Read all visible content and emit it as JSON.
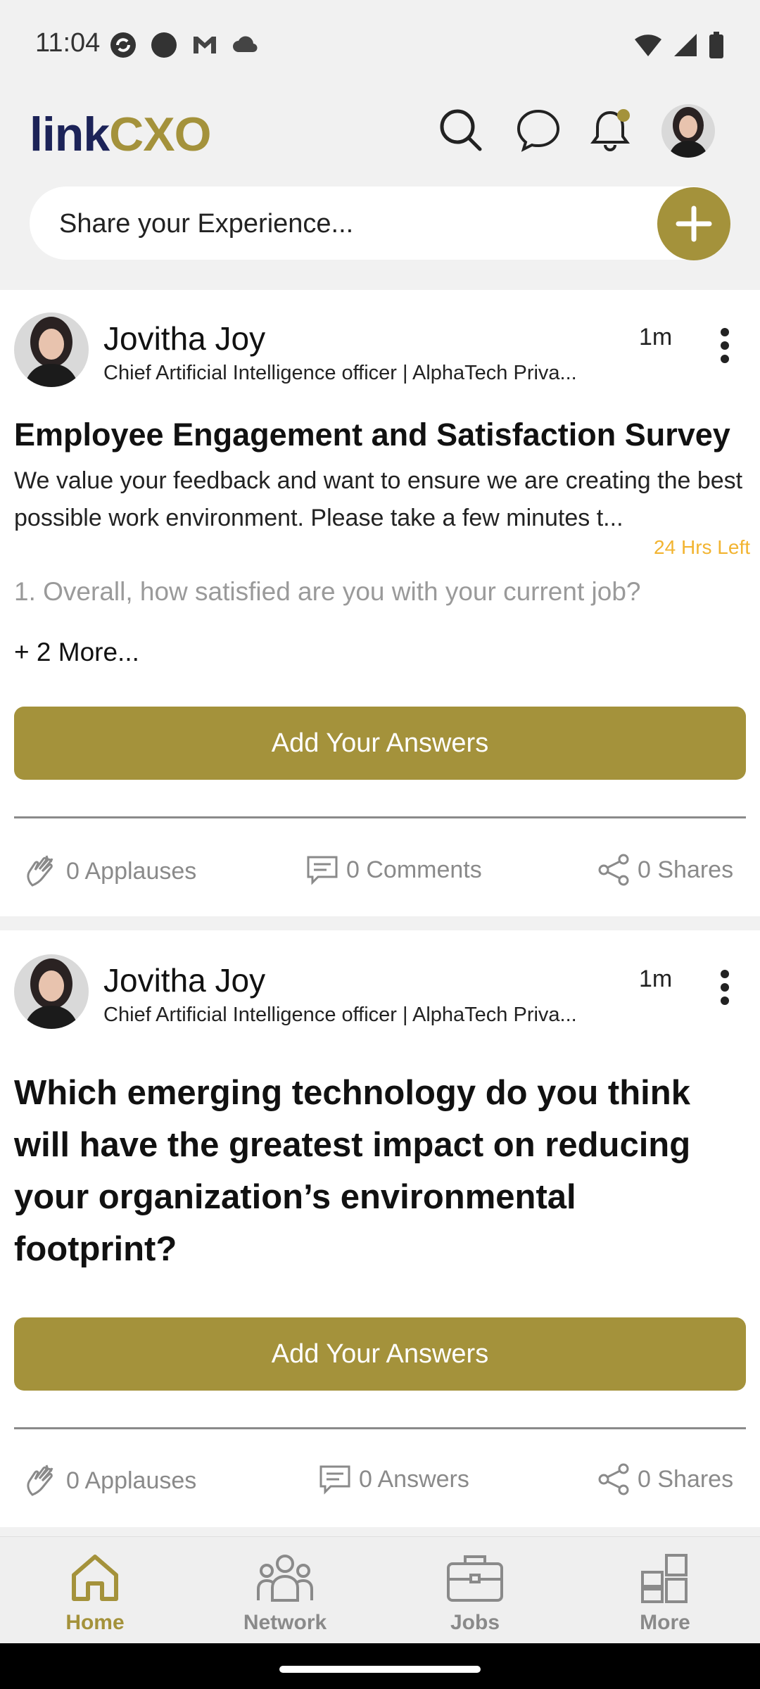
{
  "status_bar": {
    "time": "11:04"
  },
  "header": {
    "logo_part1": "link",
    "logo_part2": "CXO"
  },
  "share": {
    "placeholder": "Share your Experience..."
  },
  "posts": [
    {
      "author": "Jovitha Joy",
      "author_title": "Chief Artificial Intelligence officer | AlphaTech Priva...",
      "time": "1m",
      "title": "Employee Engagement and Satisfaction Survey",
      "description": "We value your feedback and want to ensure we are creating the best possible work environment. Please take a few minutes t...",
      "time_left": "24 Hrs Left",
      "question": "1. Overall, how satisfied are you with your current job?",
      "more": "+ 2 More...",
      "answer_button": "Add Your Answers",
      "applauses": "0 Applauses",
      "comments": "0 Comments",
      "shares": "0 Shares"
    },
    {
      "author": "Jovitha Joy",
      "author_title": "Chief Artificial Intelligence officer | AlphaTech Priva...",
      "time": "1m",
      "question": "Which emerging technology do you think will have the greatest impact on reducing your organization’s environmental footprint?",
      "answer_button": "Add Your Answers",
      "applauses": "0 Applauses",
      "answers": "0 Answers",
      "shares": "0 Shares"
    }
  ],
  "bottom_nav": [
    {
      "label": "Home",
      "icon": "home-icon",
      "active": true
    },
    {
      "label": "Network",
      "icon": "network-icon",
      "active": false
    },
    {
      "label": "Jobs",
      "icon": "briefcase-icon",
      "active": false
    },
    {
      "label": "More",
      "icon": "grid-icon",
      "active": false
    }
  ],
  "colors": {
    "accent": "#a4923b",
    "brand_dark": "#1c2358",
    "warning": "#f2b431",
    "muted": "#8a8a8a"
  }
}
